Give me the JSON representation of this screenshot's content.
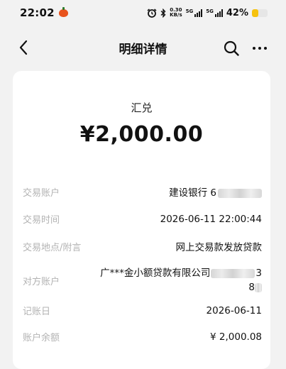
{
  "status_bar": {
    "time": "22:02",
    "net_speed_value": "0.30",
    "net_speed_unit": "KB/s",
    "sim1_label": "5G",
    "sim2_label": "5G",
    "battery_percent_text": "42%",
    "battery_level": 0.42,
    "battery_color": "#f6c20e",
    "icons": [
      "pumpkin-icon",
      "alarm-icon",
      "bluetooth-icon",
      "signal-icon",
      "battery-icon"
    ]
  },
  "nav": {
    "title": "明细详情",
    "back_icon": "chevron-left-icon",
    "search_icon": "search-icon",
    "more_icon": "more-dots-icon"
  },
  "detail": {
    "type": "汇兑",
    "amount": "¥2,000.00",
    "rows": [
      {
        "label": "交易账户",
        "value": "建设银行 6"
      },
      {
        "label": "交易时间",
        "value": "2026-06-11 22:00:44"
      },
      {
        "label": "交易地点/附言",
        "value": "网上交易款发放贷款"
      },
      {
        "label": "对方账户",
        "value_line1": "广***金小额贷款有限公司",
        "value_line1_tail": "3",
        "value_line2": "8"
      },
      {
        "label": "记账日",
        "value": "2026-06-11"
      },
      {
        "label": "账户余额",
        "value": "¥ 2,000.08"
      }
    ]
  }
}
